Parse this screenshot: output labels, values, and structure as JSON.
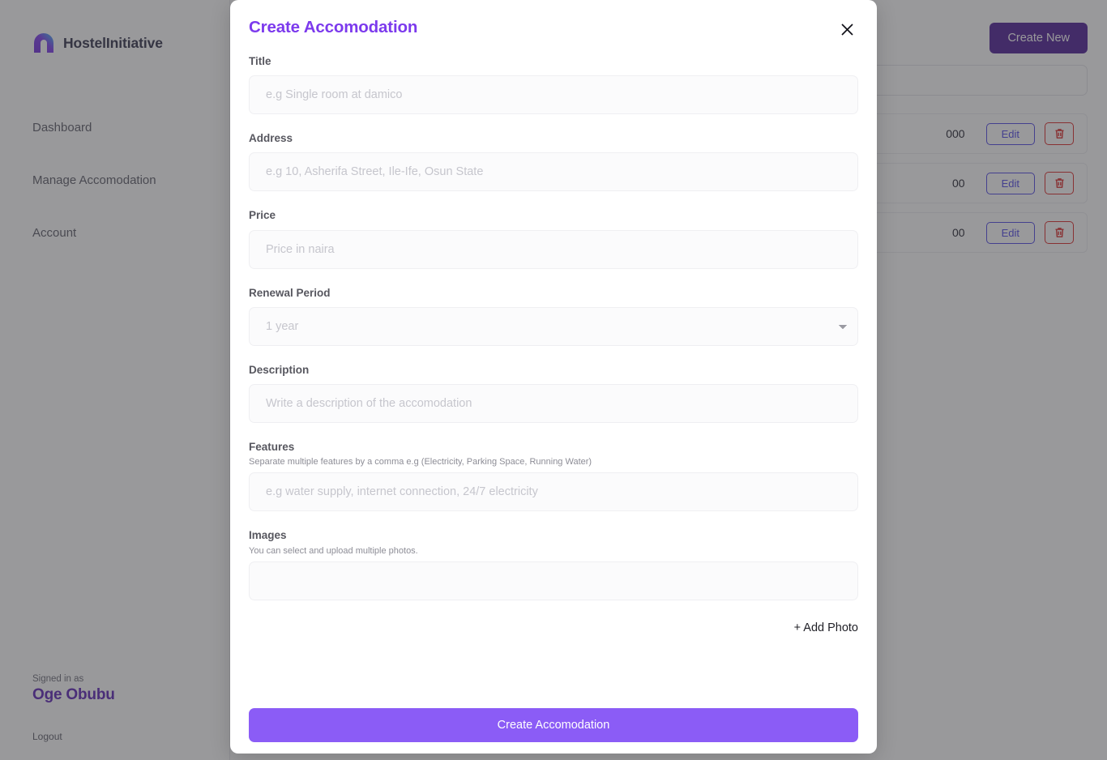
{
  "sidebar": {
    "brand": "HostelInitiative",
    "nav": [
      {
        "label": "Dashboard"
      },
      {
        "label": "Manage Accomodation"
      },
      {
        "label": "Account"
      }
    ],
    "signed_in_label": "Signed in as",
    "user_name": "Oge Obubu",
    "logout_label": "Logout"
  },
  "main": {
    "create_new_label": "Create New",
    "search_placeholder": "",
    "search_value": "",
    "rows": [
      {
        "title": "",
        "price": "000",
        "edit_label": "Edit"
      },
      {
        "title": "",
        "price": "00",
        "edit_label": "Edit"
      },
      {
        "title": "",
        "price": "00",
        "edit_label": "Edit"
      }
    ]
  },
  "modal": {
    "title": "Create Accomodation",
    "close_label": "✕",
    "fields": {
      "title": {
        "label": "Title",
        "placeholder": "e.g Single room at damico",
        "value": ""
      },
      "address": {
        "label": "Address",
        "placeholder": "e.g 10, Asherifa Street, Ile-Ife, Osun State",
        "value": ""
      },
      "price": {
        "label": "Price",
        "placeholder": "Price in naira",
        "value": ""
      },
      "renewal_period": {
        "label": "Renewal Period",
        "selected": "1 year",
        "options": [
          "1 year"
        ]
      },
      "description": {
        "label": "Description",
        "placeholder": "Write a description of the accomodation",
        "value": ""
      },
      "features": {
        "label": "Features",
        "hint": "Separate multiple features by a comma e.g (Electricity, Parking Space, Running Water)",
        "placeholder": "e.g water supply, internet connection, 24/7 electricity",
        "value": ""
      },
      "images": {
        "label": "Images",
        "hint": "You can select and upload multiple photos."
      }
    },
    "add_photo_label": "+ Add Photo",
    "submit_label": "Create Accomodation"
  },
  "colors": {
    "accent": "#7c3aed",
    "submit": "#8b5cf6",
    "brand_dark": "#4c1d95",
    "edit": "#4f46e5",
    "delete": "#dc2626",
    "user": "#5b21b6"
  }
}
